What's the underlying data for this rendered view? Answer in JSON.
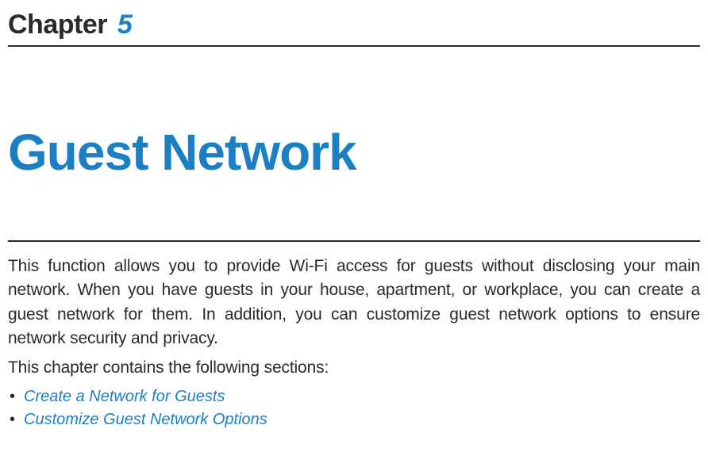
{
  "chapter": {
    "label": "Chapter",
    "number": "5",
    "title": "Guest Network"
  },
  "body": {
    "intro": "This function allows you to provide Wi-Fi access for guests without disclosing your main network. When you have guests in your house, apartment, or workplace, you can create a guest network for them. In addition, you can customize guest network options to ensure network security and privacy.",
    "lead_in": "This chapter contains the following sections:",
    "bullet": "•",
    "links": [
      {
        "label": "Create a Network for Guests"
      },
      {
        "label": "Customize Guest Network Options"
      }
    ]
  }
}
